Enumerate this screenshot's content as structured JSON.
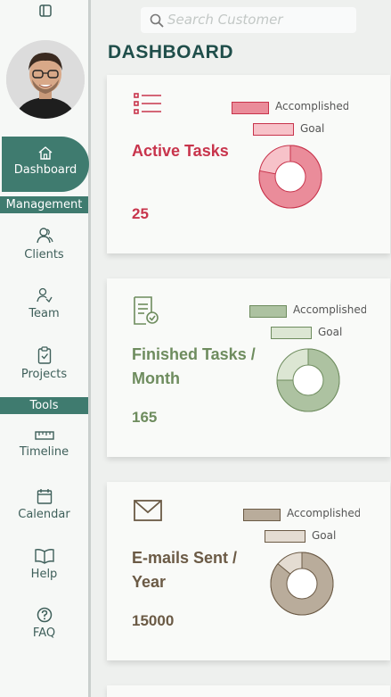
{
  "search": {
    "placeholder": "Search Customer"
  },
  "page_title": "DASHBOARD",
  "sidebar": {
    "items": [
      {
        "label": "Dashboard",
        "icon": "home-icon",
        "active": true
      },
      {
        "label": "Clients",
        "icon": "users-icon"
      },
      {
        "label": "Team",
        "icon": "team-icon"
      },
      {
        "label": "Projects",
        "icon": "clipboard-icon"
      },
      {
        "label": "Timeline",
        "icon": "ruler-icon"
      },
      {
        "label": "Calendar",
        "icon": "calendar-icon"
      },
      {
        "label": "Help",
        "icon": "book-icon"
      },
      {
        "label": "FAQ",
        "icon": "question-icon"
      }
    ],
    "sections": {
      "management": "Management",
      "tools": "Tools"
    }
  },
  "cards": [
    {
      "label": "Active Tasks",
      "value": "25",
      "icon": "list-icon",
      "color": "#c8344c",
      "legend": {
        "accomplished": "Accomplished",
        "goal": "Goal"
      },
      "accomplished_color": "#ea8c9a",
      "goal_color": "#f7c2c9",
      "accomplished_fraction": 0.78
    },
    {
      "label": "Finished Tasks / Month",
      "value": "165",
      "icon": "document-check-icon",
      "color": "#6e8c5e",
      "legend": {
        "accomplished": "Accomplished",
        "goal": "Goal"
      },
      "accomplished_color": "#adc2a1",
      "goal_color": "#dce6d3",
      "accomplished_fraction": 0.75
    },
    {
      "label": "E-mails Sent / Year",
      "value": "15000",
      "icon": "mail-icon",
      "color": "#6b5a45",
      "legend": {
        "accomplished": "Accomplished",
        "goal": "Goal"
      },
      "accomplished_color": "#b9ac9b",
      "goal_color": "#e4dcd2",
      "accomplished_fraction": 0.86
    }
  ]
}
